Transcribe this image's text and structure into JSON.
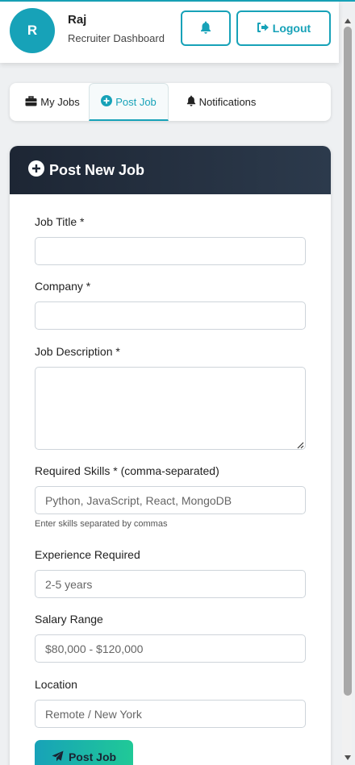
{
  "header": {
    "avatar_letter": "R",
    "user_name": "Raj",
    "user_role": "Recruiter Dashboard",
    "logout_label": "Logout"
  },
  "tabs": [
    {
      "label": "My Jobs",
      "icon": "briefcase-icon"
    },
    {
      "label": "Post Job",
      "icon": "plus-circle-icon",
      "active": true
    },
    {
      "label": "Notifications",
      "icon": "bell-icon"
    }
  ],
  "form": {
    "title": "Post New Job",
    "job_title": {
      "label": "Job Title *",
      "value": "",
      "placeholder": ""
    },
    "company": {
      "label": "Company *",
      "value": "",
      "placeholder": ""
    },
    "description": {
      "label": "Job Description *",
      "value": "",
      "placeholder": ""
    },
    "skills": {
      "label": "Required Skills * (comma-separated)",
      "placeholder": "Python, JavaScript, React, MongoDB",
      "help": "Enter skills separated by commas"
    },
    "experience": {
      "label": "Experience Required",
      "placeholder": "2-5 years"
    },
    "salary": {
      "label": "Salary Range",
      "placeholder": "$80,000 - $120,000"
    },
    "location": {
      "label": "Location",
      "placeholder": "Remote / New York"
    },
    "submit_label": "Post Job"
  },
  "colors": {
    "accent": "#17a2b8",
    "header_dark": "#1d2634",
    "gradient_end": "#20c997"
  }
}
